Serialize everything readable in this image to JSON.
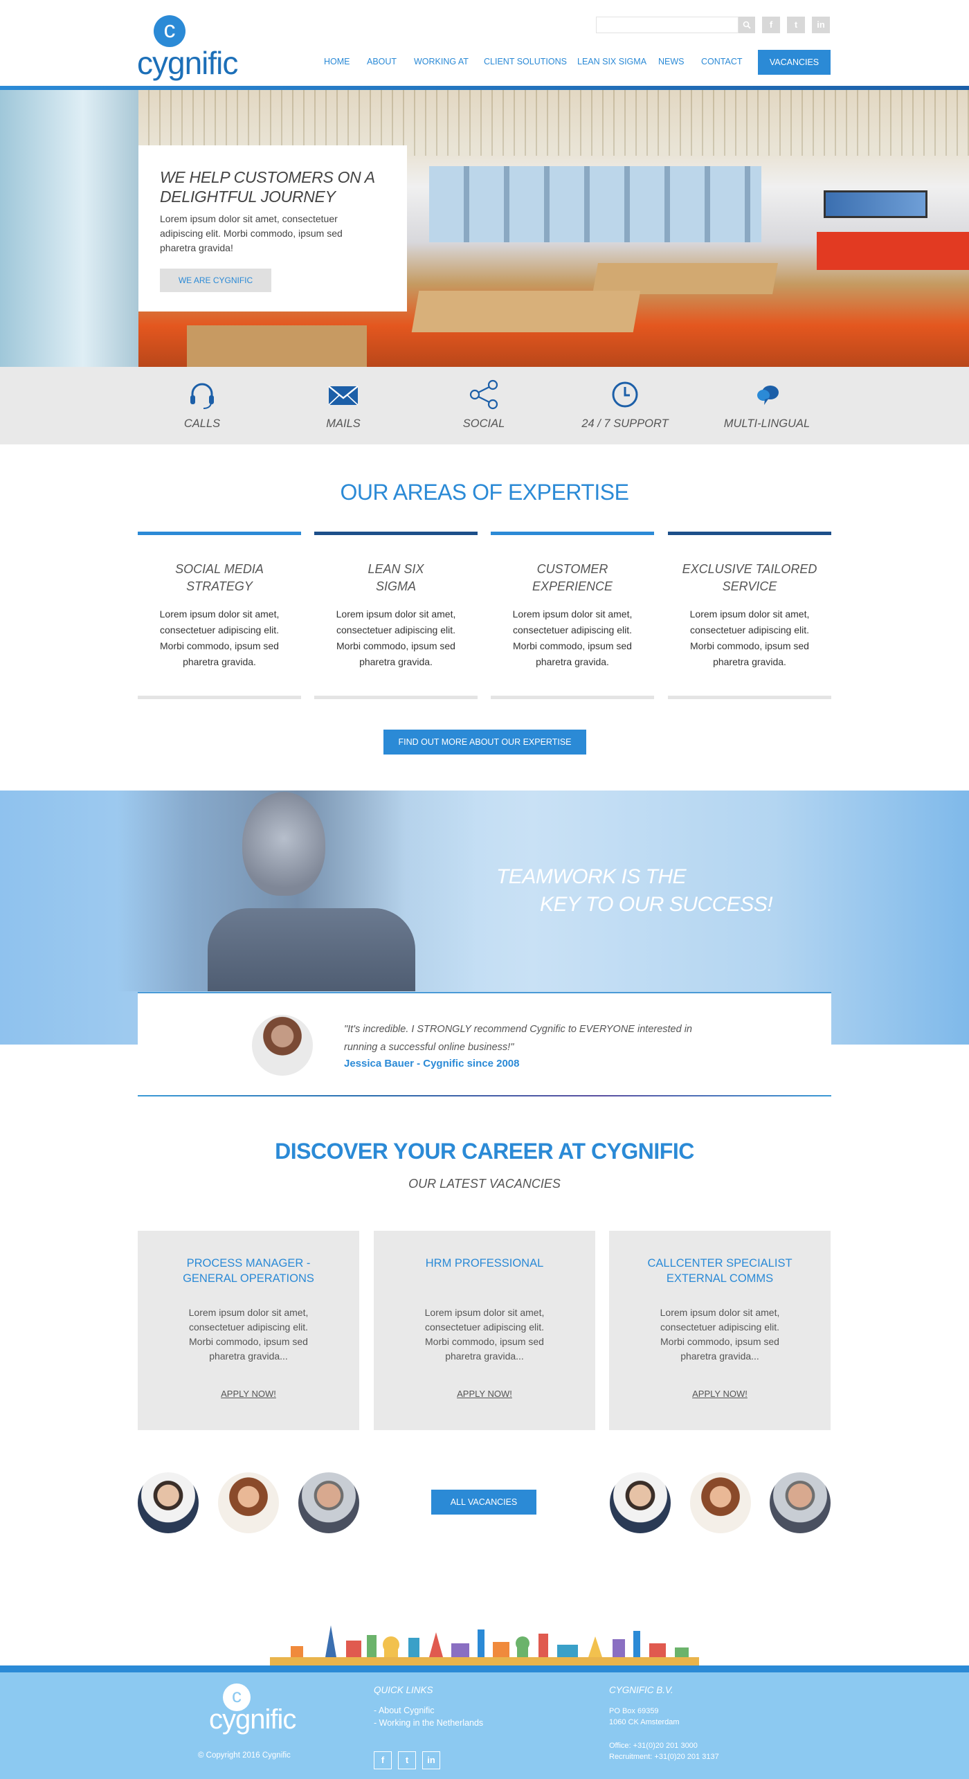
{
  "colors": {
    "accent": "#2b8ad6",
    "dark_accent": "#1c5fa8",
    "footer": "#8cc9f1",
    "panel_gray": "#e9e9e9"
  },
  "header": {
    "logo_letter": "c",
    "logo_text": "cygnific",
    "search_placeholder": "",
    "search_icon": "search-icon",
    "social_icons": [
      "f",
      "t",
      "in"
    ],
    "nav": [
      "HOME",
      "ABOUT",
      "WORKING AT",
      "CLIENT SOLUTIONS",
      "LEAN SIX SIGMA",
      "NEWS",
      "CONTACT"
    ],
    "cta": "VACANCIES"
  },
  "hero": {
    "title": "WE HELP CUSTOMERS ON A DELIGHTFUL JOURNEY",
    "text": "Lorem ipsum dolor sit amet, consectetuer adipiscing elit. Morbi commodo, ipsum sed pharetra gravida!",
    "button": "WE ARE CYGNIFIC"
  },
  "features": [
    {
      "icon": "headset-icon",
      "label": "CALLS"
    },
    {
      "icon": "mail-icon",
      "label": "MAILS"
    },
    {
      "icon": "share-icon",
      "label": "SOCIAL"
    },
    {
      "icon": "clock-icon",
      "label": "24 / 7 SUPPORT"
    },
    {
      "icon": "speech-bubbles-icon",
      "label": "MULTI-LINGUAL"
    }
  ],
  "expertise": {
    "title": "OUR AREAS OF EXPERTISE",
    "items": [
      {
        "title_1": "SOCIAL MEDIA",
        "title_2": "STRATEGY",
        "text": "Lorem ipsum dolor sit amet, consectetuer adipiscing elit. Morbi commodo, ipsum sed pharetra gravida."
      },
      {
        "title_1": "LEAN SIX",
        "title_2": "SIGMA",
        "text": "Lorem ipsum dolor sit amet, consectetuer adipiscing elit. Morbi commodo, ipsum sed pharetra gravida."
      },
      {
        "title_1": "CUSTOMER",
        "title_2": "EXPERIENCE",
        "text": "Lorem ipsum dolor sit amet, consectetuer adipiscing elit. Morbi commodo, ipsum sed pharetra gravida."
      },
      {
        "title_1": "EXCLUSIVE TAILORED",
        "title_2": "SERVICE",
        "text": "Lorem ipsum dolor sit amet, consectetuer adipiscing elit. Morbi commodo, ipsum sed pharetra gravida."
      }
    ],
    "button": "FIND OUT MORE ABOUT OUR EXPERTISE"
  },
  "banner": {
    "line1": "TEAMWORK IS THE",
    "line2": "KEY TO OUR SUCCESS!"
  },
  "testimonial": {
    "quote": "\"It's incredible. I STRONGLY recommend Cygnific to EVERYONE interested in running a successful online business!\"",
    "author": "Jessica Bauer - Cygnific since 2008"
  },
  "career": {
    "title": "DISCOVER YOUR CAREER AT CYGNIFIC",
    "subtitle": "OUR LATEST VACANCIES",
    "vacancies": [
      {
        "title_1": "PROCESS MANAGER -",
        "title_2": "GENERAL OPERATIONS",
        "text": "Lorem ipsum dolor sit amet, consectetuer adipiscing elit. Morbi commodo, ipsum sed pharetra gravida...",
        "apply": "APPLY NOW!"
      },
      {
        "title_1": "HRM PROFESSIONAL",
        "title_2": "",
        "text": "Lorem ipsum dolor sit amet, consectetuer adipiscing elit. Morbi commodo, ipsum sed pharetra gravida...",
        "apply": "APPLY NOW!"
      },
      {
        "title_1": "CALLCENTER SPECIALIST",
        "title_2": "EXTERNAL COMMS",
        "text": "Lorem ipsum dolor sit amet, consectetuer adipiscing elit. Morbi commodo, ipsum sed pharetra gravida...",
        "apply": "APPLY NOW!"
      }
    ],
    "all_button": "ALL VACANCIES"
  },
  "footer": {
    "logo_letter": "c",
    "logo_text": "cygnific",
    "copyright": "© Copyright 2016 Cygnific",
    "quick_links_title": "QUICK LINKS",
    "quick_links": [
      "- About Cygnific",
      "- Working in the Netherlands"
    ],
    "social_icons": [
      "f",
      "t",
      "in"
    ],
    "company_title": "CYGNIFIC B.V.",
    "address_1": "PO Box 69359",
    "address_2": "1060 CK Amsterdam",
    "office": "Office: +31(0)20 201 3000",
    "recruitment": "Recruitment: +31(0)20 201 3137"
  }
}
